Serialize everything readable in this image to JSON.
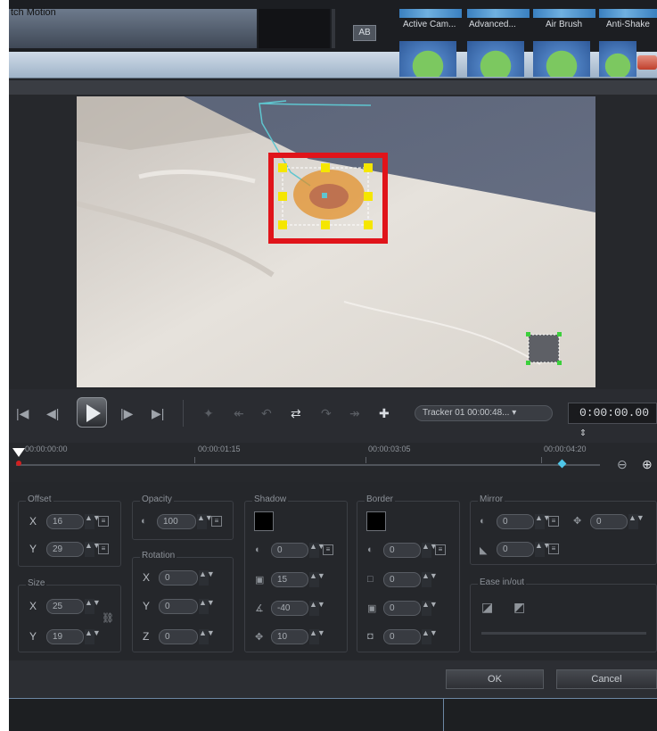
{
  "window": {
    "title": "tch Motion"
  },
  "toolbar": {
    "ab_label": "AB"
  },
  "effects": [
    {
      "label": "Active Cam..."
    },
    {
      "label": "Advanced..."
    },
    {
      "label": "Air Brush"
    },
    {
      "label": "Anti-Shake"
    }
  ],
  "transport": {
    "tracker_select": "Tracker 01   00:00:48...",
    "timecode": "0:00:00.00"
  },
  "timeline": {
    "marks": [
      "00:00:00:00",
      "00:00:01:15",
      "00:00:03:05",
      "00:00:04:20"
    ]
  },
  "offset": {
    "title": "Offset",
    "x_label": "X",
    "x": "16",
    "y_label": "Y",
    "y": "29"
  },
  "size": {
    "title": "Size",
    "x_label": "X",
    "x": "25",
    "y_label": "Y",
    "y": "19"
  },
  "opacity": {
    "title": "Opacity",
    "value": "100"
  },
  "rotation": {
    "title": "Rotation",
    "x_label": "X",
    "x": "0",
    "y_label": "Y",
    "y": "0",
    "z_label": "Z",
    "z": "0"
  },
  "shadow": {
    "title": "Shadow",
    "opacity": "0",
    "blur": "15",
    "angle": "-40",
    "distance": "10"
  },
  "border": {
    "title": "Border",
    "opacity": "0",
    "size": "0",
    "blur": "0",
    "edge": "0"
  },
  "mirror": {
    "title": "Mirror",
    "opacity": "0",
    "offset": "0",
    "fade": "0"
  },
  "ease": {
    "title": "Ease in/out"
  },
  "buttons": {
    "ok": "OK",
    "cancel": "Cancel"
  },
  "colors": {
    "tracker_box": "#e0141a",
    "handle": "#f5e600",
    "path": "#5fc5cf"
  }
}
